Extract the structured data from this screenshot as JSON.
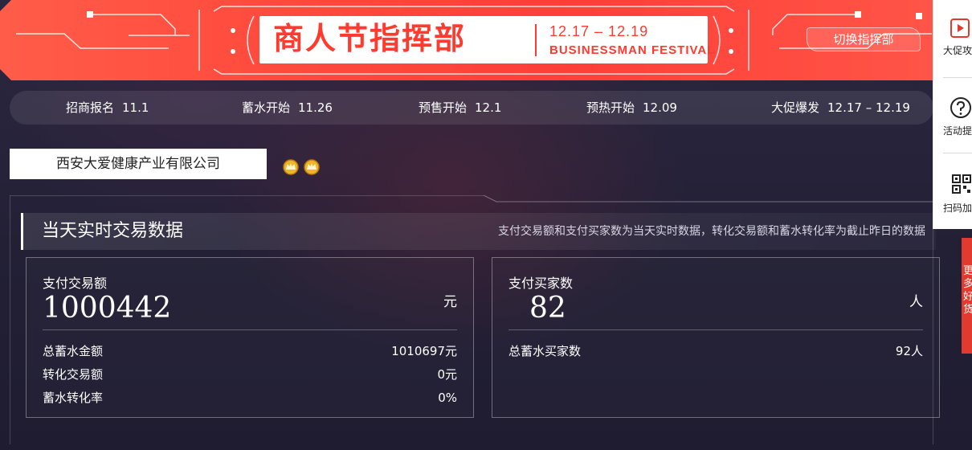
{
  "banner": {
    "title": "商人节指挥部",
    "dates": "12.17 – 12.19",
    "subtitle": "BUSINESSMAN FESTIVAL",
    "switch_label": "切换指挥部"
  },
  "timeline": [
    {
      "label": "招商报名",
      "date": "11.1"
    },
    {
      "label": "蓄水开始",
      "date": "11.26"
    },
    {
      "label": "预售开始",
      "date": "12.1"
    },
    {
      "label": "预热开始",
      "date": "12.09"
    },
    {
      "label": "大促爆发",
      "date": "12.17 – 12.19"
    }
  ],
  "company": {
    "name": "西安大爱健康产业有限公司",
    "badge_icon": "crown-icon"
  },
  "panel": {
    "title": "当天实时交易数据",
    "note": "支付交易额和支付买家数为当天实时数据，转化交易额和蓄水转化率为截止昨日的数据"
  },
  "cards": {
    "amount": {
      "label": "支付交易额",
      "value": "1000442",
      "unit": "元",
      "rows": [
        {
          "label": "总蓄水金额",
          "value": "1010697元"
        },
        {
          "label": "转化交易额",
          "value": "0元"
        },
        {
          "label": "蓄水转化率",
          "value": "0%"
        }
      ]
    },
    "buyers": {
      "label": "支付买家数",
      "value": "82",
      "unit": "人",
      "rows": [
        {
          "label": "总蓄水买家数",
          "value": "92人"
        }
      ]
    }
  },
  "dock": {
    "items": [
      {
        "label": "大促攻",
        "icon": "play-icon"
      },
      {
        "label": "活动提",
        "icon": "help-icon"
      },
      {
        "label": "扫码加",
        "icon": "qrcode-icon"
      }
    ],
    "side_tab": "更多好货"
  },
  "colors": {
    "banner_red": "#ff4a3c",
    "background": "#252238",
    "accent_red": "#e33a2f"
  }
}
